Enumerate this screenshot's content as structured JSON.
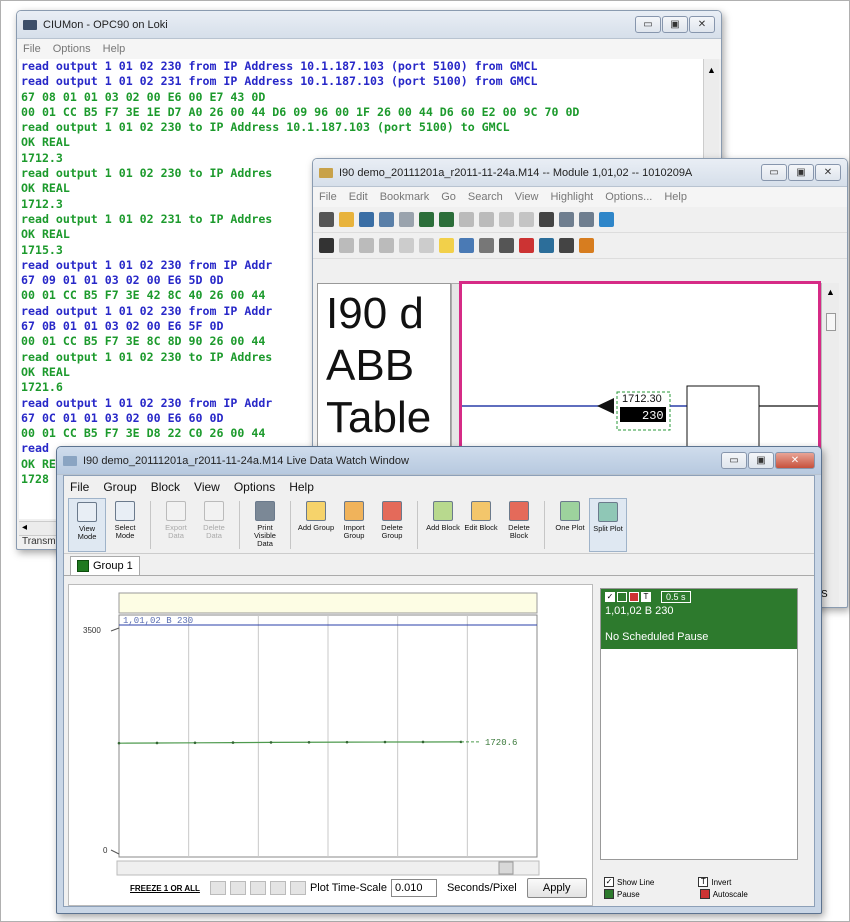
{
  "ciumon": {
    "title": "CIUMon - OPC90 on Loki",
    "menu": [
      "File",
      "Options",
      "Help"
    ],
    "lines": [
      {
        "text": "read output 1 01 02 230 from IP Address 10.1.187.103 (port 5100) from GMCL",
        "color": "blue"
      },
      {
        "text": "read output 1 01 02 231 from IP Address 10.1.187.103 (port 5100) from GMCL",
        "color": "blue"
      },
      {
        "text": "67 08 01 01 03 02 00 E6 00 E7 43 0D",
        "color": "green"
      },
      {
        "text": "00 01 CC B5 F7 3E 1E D7 A0 26 00 44 D6 09 96 00 1F 26 00 44 D6 60 E2 00 9C 70 0D",
        "color": "green"
      },
      {
        "text": "read output 1 01 02 230 to IP Address 10.1.187.103 (port 5100) to GMCL",
        "color": "green"
      },
      {
        "text": "OK REAL",
        "color": "green"
      },
      {
        "text": "1712.3",
        "color": "green"
      },
      {
        "text": "read output 1 01 02 230 to IP Addres",
        "color": "green"
      },
      {
        "text": "OK REAL",
        "color": "green"
      },
      {
        "text": "1712.3",
        "color": "green"
      },
      {
        "text": "read output 1 01 02 231 to IP Addres",
        "color": "green"
      },
      {
        "text": "OK REAL",
        "color": "green"
      },
      {
        "text": "1715.3",
        "color": "green"
      },
      {
        "text": "read output 1 01 02 230 from IP Addr",
        "color": "blue"
      },
      {
        "text": "67 09 01 01 03 02 00 E6 5D 0D",
        "color": "blue"
      },
      {
        "text": "00 01 CC B5 F7 3E 42 8C 40 26 00 44",
        "color": "green"
      },
      {
        "text": "read output 1 01 02 230 from IP Addr",
        "color": "blue"
      },
      {
        "text": "67 0B 01 01 03 02 00 E6 5F 0D",
        "color": "blue"
      },
      {
        "text": "00 01 CC B5 F7 3E 8C 8D 90 26 00 44",
        "color": "green"
      },
      {
        "text": "read output 1 01 02 230 to IP Addres",
        "color": "green"
      },
      {
        "text": "OK REAL",
        "color": "green"
      },
      {
        "text": "1721.6",
        "color": "green"
      },
      {
        "text": "read output 1 01 02 230 from IP Addr",
        "color": "blue"
      },
      {
        "text": "67 0C 01 01 03 02 00 E6 60 0D",
        "color": "blue"
      },
      {
        "text": "00 01 CC B5 F7 3E D8 22 C0 26 00 44",
        "color": "green"
      },
      {
        "text": "read",
        "color": "blue"
      },
      {
        "text": "OK RE",
        "color": "green"
      },
      {
        "text": "1728",
        "color": "green"
      }
    ],
    "status_text": "Transm"
  },
  "module": {
    "title": "I90 demo_20111201a_r2011-11-24a.M14 -- Module 1,01,02 -- 1010209A",
    "menu": [
      "File",
      "Edit",
      "Bookmark",
      "Go",
      "Search",
      "View",
      "Highlight",
      "Options...",
      "Help"
    ],
    "left_text": [
      "I90 d",
      "ABB",
      "Table"
    ],
    "block_value_label": "1712.30",
    "block_value": "230",
    "status_right": "S"
  },
  "live": {
    "title": "I90 demo_20111201a_r2011-11-24a.M14 Live Data Watch Window",
    "menu": [
      "File",
      "Group",
      "Block",
      "View",
      "Options",
      "Help"
    ],
    "buttons": [
      {
        "label": "View Mode",
        "enabled": true,
        "selected": true
      },
      {
        "label": "Select Mode",
        "enabled": true
      },
      {
        "label": "Export Data",
        "enabled": false
      },
      {
        "label": "Delete Data",
        "enabled": false
      },
      {
        "label": "Print Visible Data",
        "enabled": true
      },
      {
        "label": "Add Group",
        "enabled": true
      },
      {
        "label": "Import Group",
        "enabled": true
      },
      {
        "label": "Delete Group",
        "enabled": true
      },
      {
        "label": "Add Block",
        "enabled": true
      },
      {
        "label": "Edit Block",
        "enabled": true
      },
      {
        "label": "Delete Block",
        "enabled": true
      },
      {
        "label": "One Plot",
        "enabled": true
      },
      {
        "label": "Split Plot",
        "enabled": true,
        "selected": true
      }
    ],
    "tab": "Group 1",
    "plot": {
      "series_label": "1,01,02 B 230",
      "y_top_label": "3500",
      "y_bottom_label": "0",
      "end_value_label": "1720.6"
    },
    "side": {
      "interval": "0.5 s",
      "block": "1,01,02 B 230",
      "status": "No Scheduled Pause"
    },
    "bottom": {
      "freeze_label": "FREEZE 1 OR ALL",
      "timescale_label": "Plot Time-Scale",
      "timescale_value": "0.010",
      "units_label": "Seconds/Pixel",
      "apply_label": "Apply"
    },
    "checks": {
      "show_line": "Show Line",
      "invert": "Invert",
      "pause": "Pause",
      "autoscale": "Autoscale"
    }
  },
  "chart_data": {
    "type": "line",
    "series": [
      {
        "name": "1,01,02 B 230",
        "values": [
          1700,
          1703,
          1706,
          1709,
          1712,
          1714,
          1716,
          1718,
          1719,
          1720.6
        ]
      }
    ],
    "ylim": [
      0,
      3500
    ],
    "end_label": "1720.6"
  }
}
